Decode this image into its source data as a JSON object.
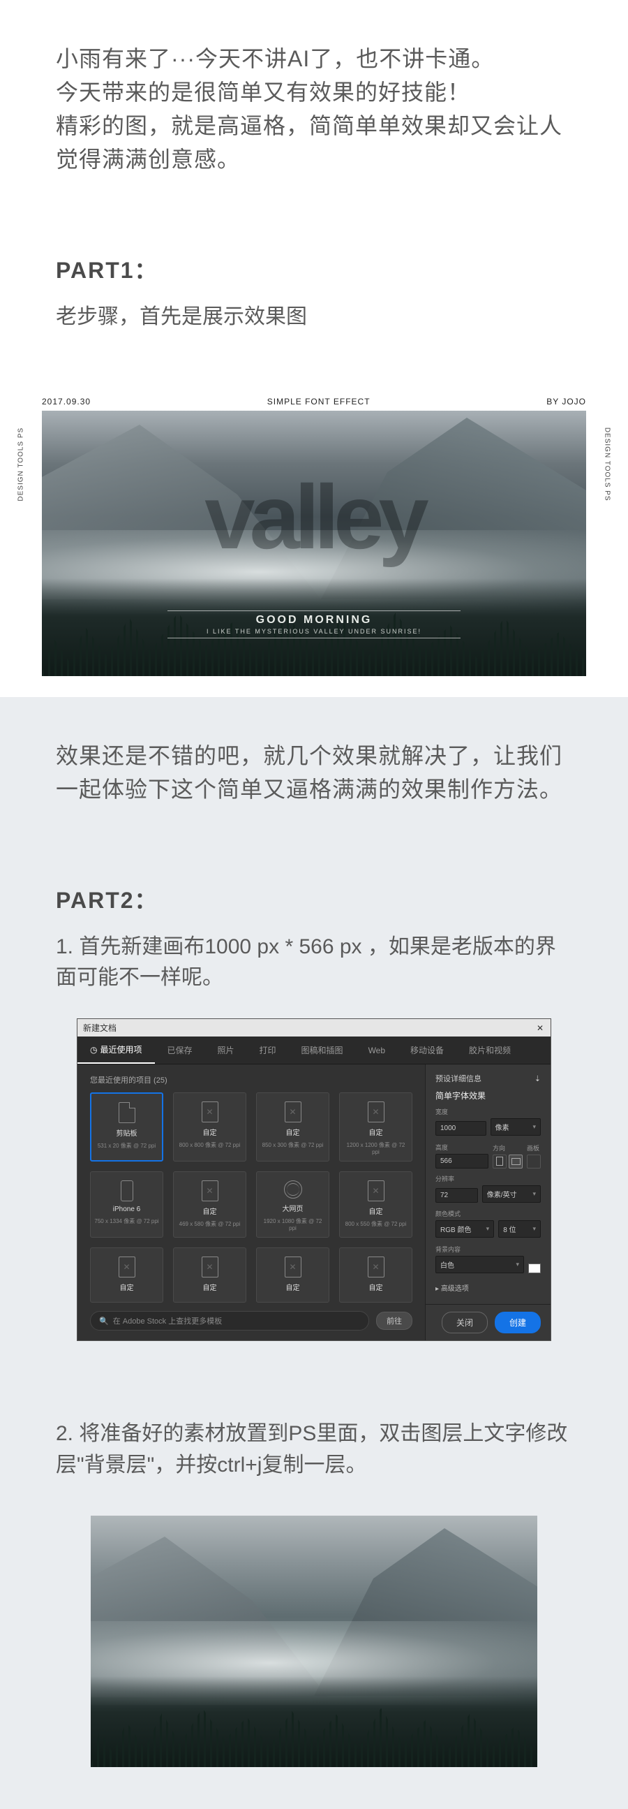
{
  "intro": {
    "line1": "小雨有来了···今天不讲AI了，也不讲卡通。",
    "line2": "今天带来的是很简单又有效果的好技能！",
    "line3": "精彩的图，就是高逼格，简简单单效果却又会让人觉得满满创意感。"
  },
  "part1": {
    "title": "PART1：",
    "subtitle": "老步骤，首先是展示效果图"
  },
  "hero": {
    "date": "2017.09.30",
    "center": "SIMPLE FONT EFFECT",
    "author": "BY JOJO",
    "side": "DESIGN TOOLS PS",
    "word": "valley",
    "caption_title": "GOOD MORNING",
    "caption_sub": "I LIKE THE MYSTERIOUS VALLEY UNDER SUNRISE!"
  },
  "after_hero": "效果还是不错的吧，就几个效果就解决了，让我们一起体验下这个简单又逼格满满的效果制作方法。",
  "part2": {
    "title": "PART2：",
    "step1": "1. 首先新建画布1000 px * 566 px ，如果是老版本的界面可能不一样呢。",
    "step2": "2. 将准备好的素材放置到PS里面，双击图层上文字修改层\"背景层\"，并按ctrl+j复制一层。"
  },
  "dialog": {
    "title": "新建文档",
    "tabs": [
      "最近使用项",
      "已保存",
      "照片",
      "打印",
      "图稿和插图",
      "Web",
      "移动设备",
      "胶片和视频"
    ],
    "recent_label": "您最近使用的项目 (25)",
    "presets": [
      {
        "name": "剪贴板",
        "dim": "531 x 20 像素 @ 72 ppi",
        "selected": true,
        "icon": "fold"
      },
      {
        "name": "自定",
        "dim": "800 x 800 像素 @ 72 ppi",
        "icon": "placeholder"
      },
      {
        "name": "自定",
        "dim": "850 x 300 像素 @ 72 ppi",
        "icon": "placeholder"
      },
      {
        "name": "自定",
        "dim": "1200 x 1200 像素 @ 72 ppi",
        "icon": "placeholder"
      },
      {
        "name": "iPhone 6",
        "dim": "750 x 1334 像素 @ 72 ppi",
        "icon": "phone"
      },
      {
        "name": "自定",
        "dim": "469 x 580 像素 @ 72 ppi",
        "icon": "placeholder"
      },
      {
        "name": "大网页",
        "dim": "1920 x 1080 像素 @ 72 ppi",
        "icon": "globe"
      },
      {
        "name": "自定",
        "dim": "800 x 550 像素 @ 72 ppi",
        "icon": "placeholder"
      },
      {
        "name": "自定",
        "dim": "",
        "icon": "placeholder"
      },
      {
        "name": "自定",
        "dim": "",
        "icon": "placeholder"
      },
      {
        "name": "自定",
        "dim": "",
        "icon": "placeholder"
      },
      {
        "name": "自定",
        "dim": "",
        "icon": "placeholder"
      }
    ],
    "search_placeholder": "在 Adobe Stock 上查找更多模板",
    "go": "前往",
    "detail": {
      "header": "预设详细信息",
      "name": "简单字体效果",
      "width_label": "宽度",
      "width_value": "1000",
      "unit": "像素",
      "height_label": "高度",
      "height_value": "566",
      "orient_label": "方向",
      "artboard_label": "画板",
      "res_label": "分辨率",
      "res_value": "72",
      "res_unit": "像素/英寸",
      "color_label": "颜色模式",
      "color_value": "RGB 颜色",
      "bit": "8 位",
      "bg_label": "背景内容",
      "bg_value": "白色",
      "advanced": "高级选项"
    },
    "cancel": "关闭",
    "create": "创建"
  }
}
